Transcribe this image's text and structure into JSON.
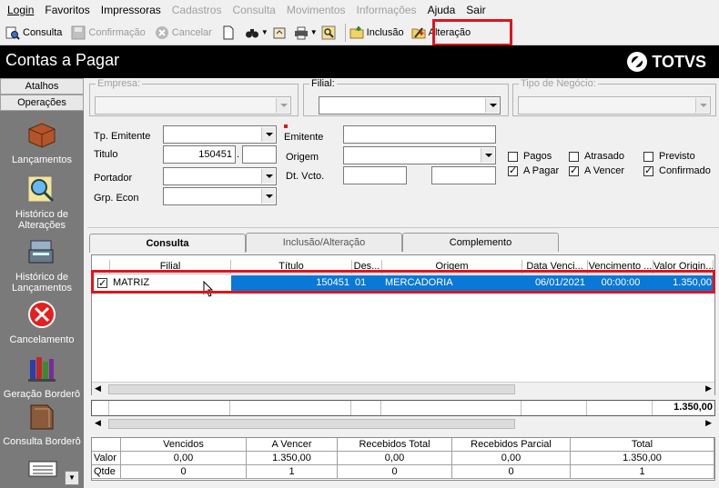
{
  "menu": {
    "items": [
      {
        "label": "Login",
        "enabled": true
      },
      {
        "label": "Favoritos",
        "enabled": true
      },
      {
        "label": "Impressoras",
        "enabled": true
      },
      {
        "label": "Cadastros",
        "enabled": false
      },
      {
        "label": "Consulta",
        "enabled": false
      },
      {
        "label": "Movimentos",
        "enabled": false
      },
      {
        "label": "Informações",
        "enabled": false
      },
      {
        "label": "Ajuda",
        "enabled": true
      },
      {
        "label": "Sair",
        "enabled": true
      }
    ]
  },
  "toolbar": {
    "consulta": "Consulta",
    "confirmacao": "Confirmação",
    "cancelar": "Cancelar",
    "inclusao": "Inclusão",
    "alteracao": "Alteração"
  },
  "header": {
    "title": "Contas a Pagar",
    "logo": "TOTVS"
  },
  "sidebar": {
    "tabs": [
      "Atalhos",
      "Operações"
    ],
    "items": [
      {
        "label": "Lançamentos",
        "icon": "box-icon"
      },
      {
        "label": "Histórico de Alterações",
        "icon": "magnifier-icon"
      },
      {
        "label": "Histórico de Lançamentos",
        "icon": "register-icon"
      },
      {
        "label": "Cancelamento",
        "icon": "cancel-icon"
      },
      {
        "label": "Geração Borderô",
        "icon": "books-icon"
      },
      {
        "label": "Consulta Borderô",
        "icon": "folder-icon"
      }
    ]
  },
  "filters": {
    "empresa_label": "Empresa:",
    "filial_label": "Filial:",
    "tipo_negocio_label": "Tipo de Negócio:",
    "tp_emitente_label": "Tp. Emitente",
    "titulo_label": "Titulo",
    "titulo_value": "150451",
    "titulo_sep": ".",
    "portador_label": "Portador",
    "grp_econ_label": "Grp. Econ",
    "emitente_label": "Emitente",
    "origem_label": "Origem",
    "dt_vcto_label": "Dt. Vcto.",
    "checks": [
      {
        "label": "Pagos",
        "checked": false
      },
      {
        "label": "Atrasado",
        "checked": false
      },
      {
        "label": "Previsto",
        "checked": false
      },
      {
        "label": "A Pagar",
        "checked": true
      },
      {
        "label": "A Vencer",
        "checked": true
      },
      {
        "label": "Confirmado",
        "checked": true
      }
    ]
  },
  "tabs": [
    "Consulta",
    "Inclusão/Alteração",
    "Complemento"
  ],
  "grid": {
    "columns": [
      "Filial",
      "Título",
      "Des...",
      "Origem",
      "Data Venci...",
      "Vencimento ...",
      "Valor Origin..."
    ],
    "rows": [
      {
        "checked": true,
        "filial": "MATRIZ",
        "titulo": "150451",
        "des": "01",
        "origem": "MERCADORIA",
        "data_venc": "06/01/2021",
        "vencimento": "00:00:00",
        "valor": "1.350,00"
      }
    ],
    "total": "1.350,00"
  },
  "summary": {
    "headers": [
      "Vencidos",
      "A Vencer",
      "Recebidos Total",
      "Recebidos Parcial",
      "Total"
    ],
    "rows": [
      {
        "label": "Valor",
        "values": [
          "0,00",
          "1.350,00",
          "0,00",
          "0,00",
          "1.350,00"
        ]
      },
      {
        "label": "Qtde",
        "values": [
          "0",
          "1",
          "0",
          "0",
          "1"
        ]
      }
    ]
  }
}
